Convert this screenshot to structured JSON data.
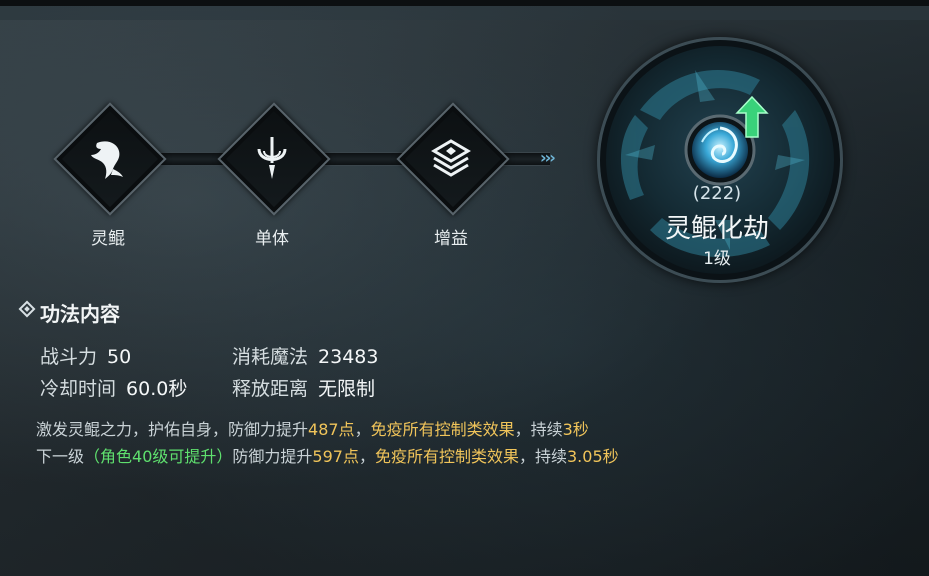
{
  "skill_chain": [
    {
      "label": "灵鲲",
      "icon": "whale-icon"
    },
    {
      "label": "单体",
      "icon": "single-target-icon"
    },
    {
      "label": "增益",
      "icon": "buff-layers-icon"
    }
  ],
  "chain_arrows": "›››",
  "skill": {
    "count": "(222)",
    "name": "灵鲲化劫",
    "level": "1级",
    "emblem_icon": "spiral-orb-icon",
    "upgrade_icon": "upgrade-arrow-icon"
  },
  "content": {
    "title": "功法内容",
    "stats": {
      "power_label": "战斗力",
      "power_value": "50",
      "mana_label": "消耗魔法",
      "mana_value": "23483",
      "cooldown_label": "冷却时间",
      "cooldown_value": "60.0秒",
      "range_label": "释放距离",
      "range_value": "无限制"
    },
    "desc_current": {
      "prefix": "激发灵鲲之力，护佑自身，防御力提升",
      "defense": "487点",
      "sep": "，",
      "immune": "免疫所有控制类效果",
      "mid": "，持续",
      "duration": "3秒"
    },
    "desc_next": {
      "prefix": "下一级",
      "requirement": "（角色40级可提升）",
      "mid1": "防御力提升",
      "defense": "597点",
      "sep": "，",
      "immune": "免疫所有控制类效果",
      "mid2": "，持续",
      "duration": "3.05秒"
    }
  },
  "colors": {
    "highlight_yellow": "#f0c45a",
    "requirement_green": "#5fe06e",
    "accent_cyan": "#6fb6d8"
  }
}
